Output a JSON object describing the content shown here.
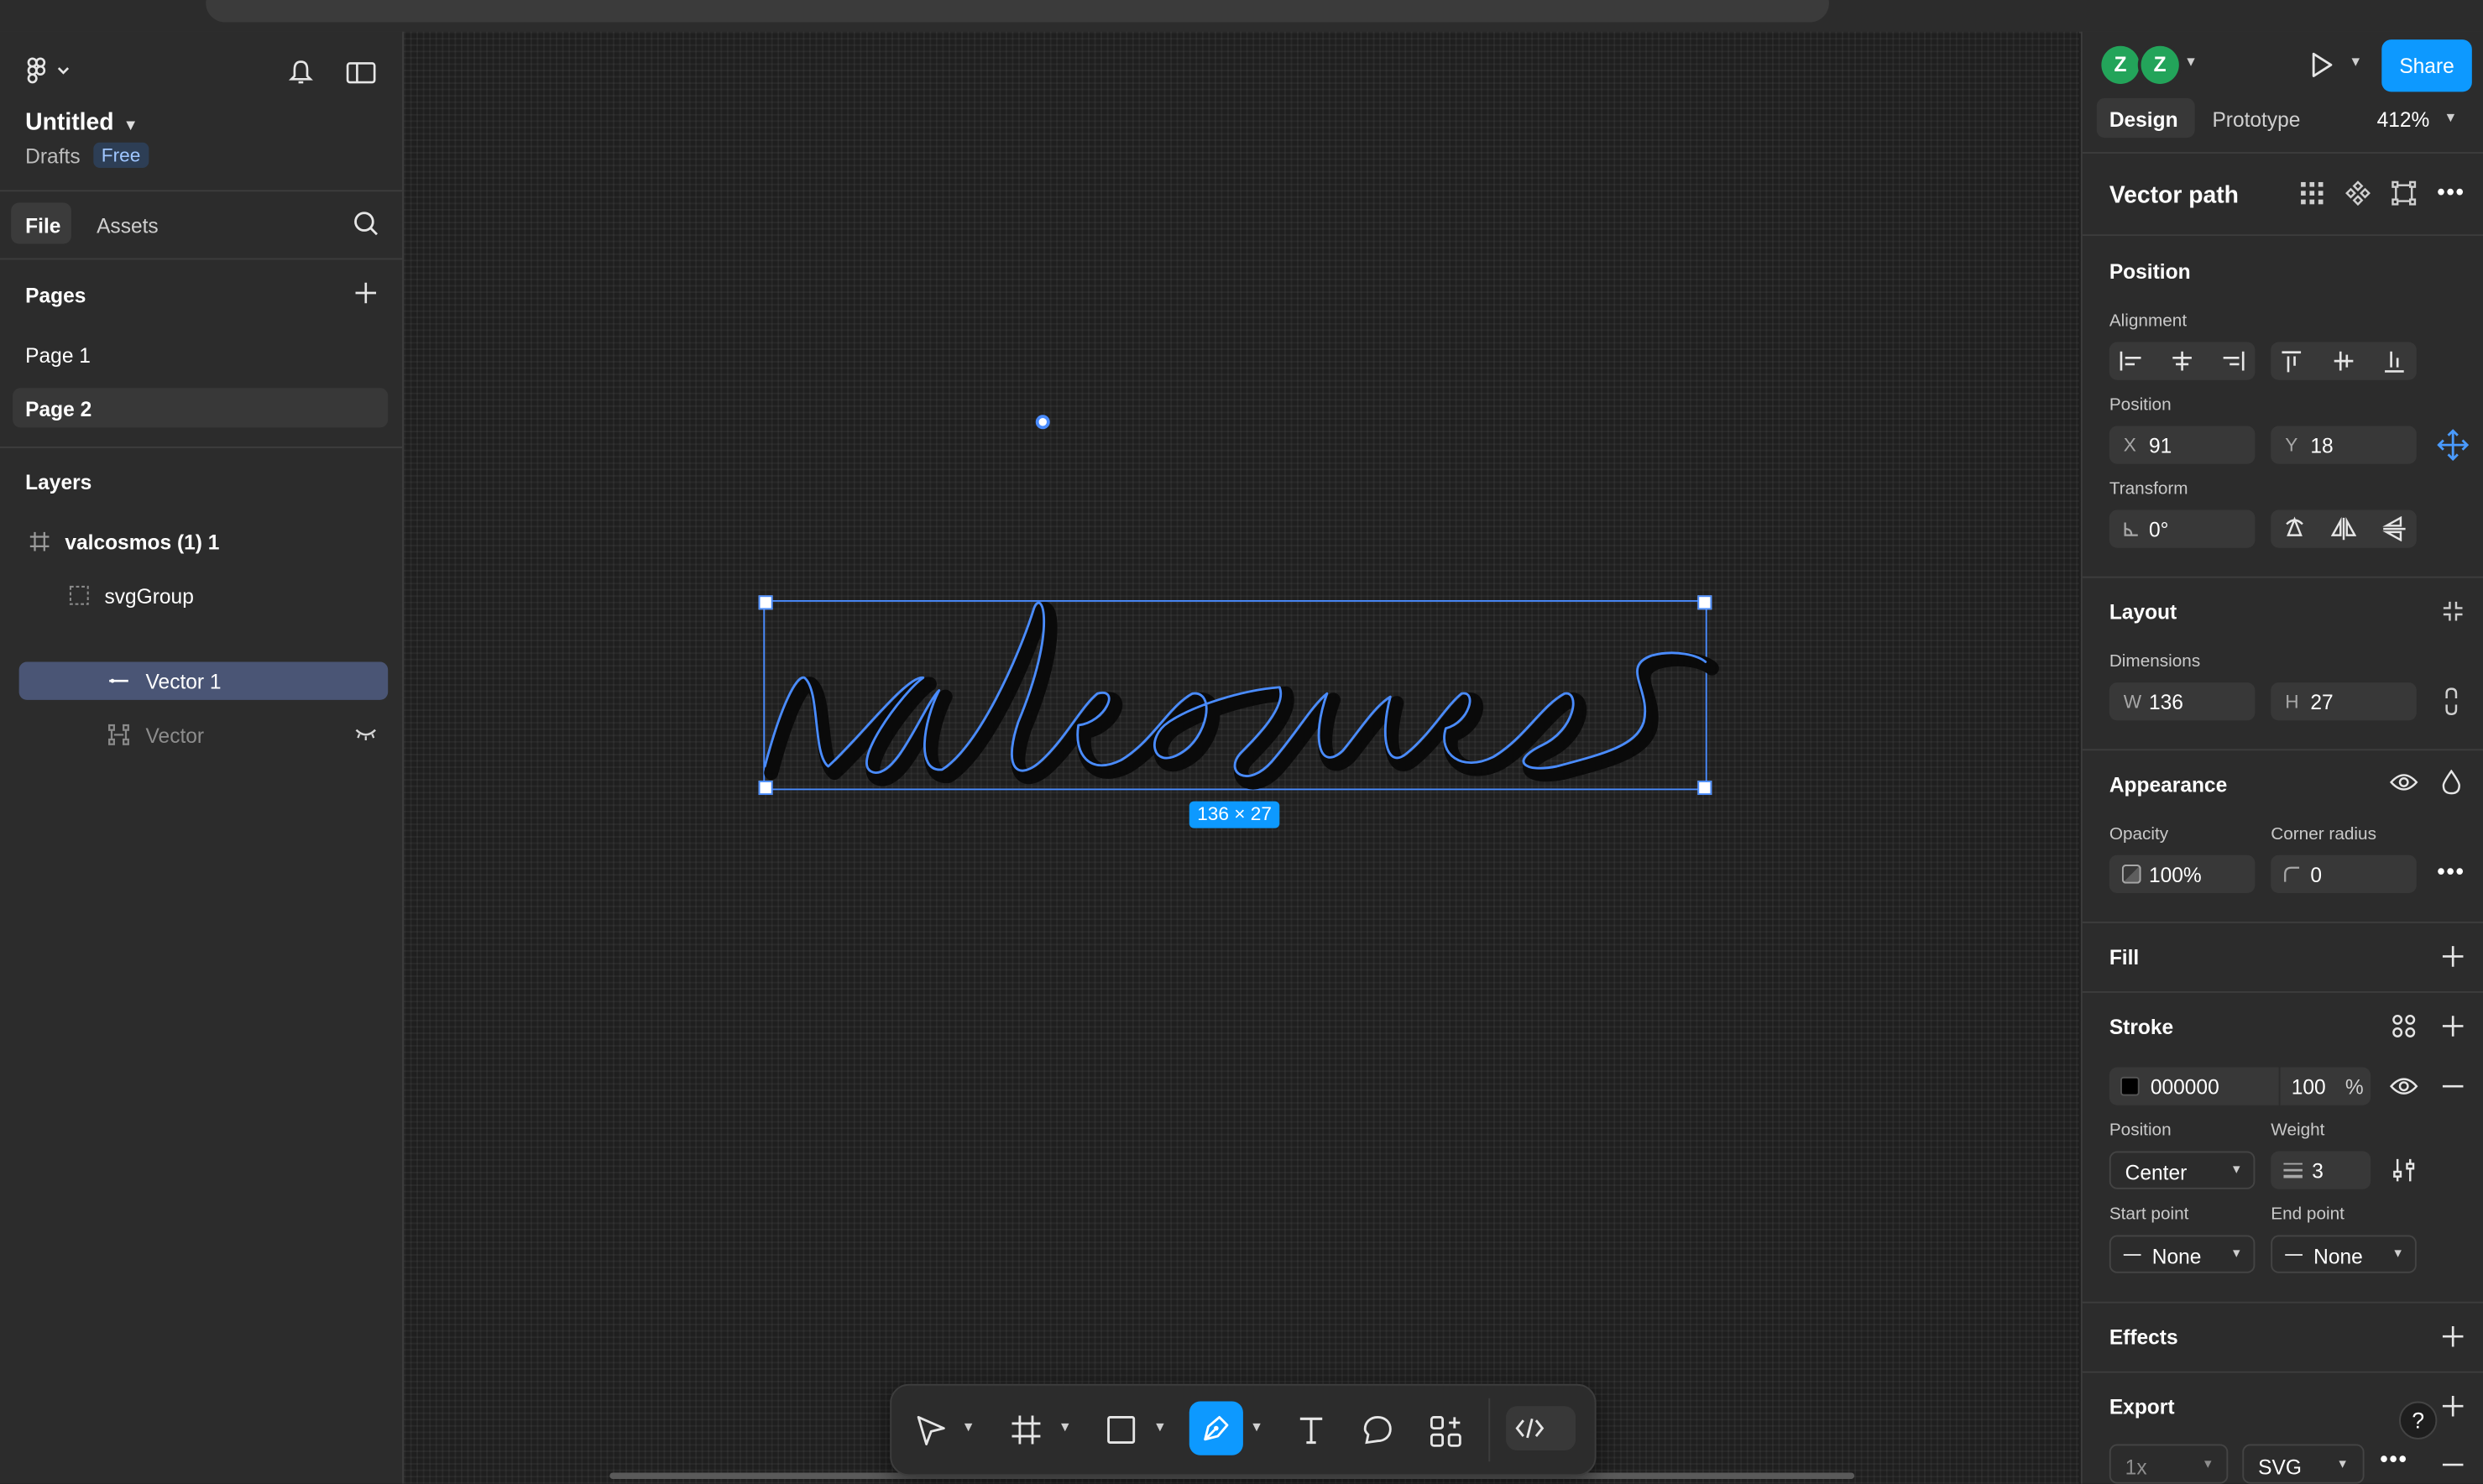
{
  "file": {
    "title": "Untitled",
    "location": "Drafts",
    "plan_badge": "Free"
  },
  "left_tabs": {
    "file": "File",
    "assets": "Assets"
  },
  "pages": {
    "heading": "Pages",
    "items": [
      "Page 1",
      "Page 2"
    ],
    "selected": "Page 2"
  },
  "layers": {
    "heading": "Layers",
    "items": [
      {
        "label": "valcosmos (1) 1",
        "icon": "frame-icon"
      },
      {
        "label": "svgGroup",
        "icon": "group-icon"
      },
      {
        "label": "Vector 1",
        "icon": "vector-line-icon",
        "selected": true
      },
      {
        "label": "Vector",
        "icon": "vector-icon",
        "hidden": true
      }
    ]
  },
  "canvas": {
    "selection_size_label": "136 × 27",
    "artwork_text": "valeosmes"
  },
  "header": {
    "avatars": [
      "Z",
      "Z"
    ],
    "share_label": "Share",
    "tabs": [
      "Design",
      "Prototype"
    ],
    "zoom": "412%"
  },
  "inspector": {
    "title": "Vector path",
    "position_section": "Position",
    "alignment_label": "Alignment",
    "position_label": "Position",
    "x_label": "X",
    "x_value": "91",
    "y_label": "Y",
    "y_value": "18",
    "transform_label": "Transform",
    "rotation": "0°",
    "layout_section": "Layout",
    "dimensions_label": "Dimensions",
    "w_label": "W",
    "w_value": "136",
    "h_label": "H",
    "h_value": "27",
    "appearance_section": "Appearance",
    "opacity_label": "Opacity",
    "opacity_value": "100%",
    "corner_label": "Corner radius",
    "corner_value": "0",
    "fill_section": "Fill",
    "stroke_section": "Stroke",
    "stroke_color": "000000",
    "stroke_opacity": "100",
    "stroke_percent": "%",
    "stroke_position_label": "Position",
    "stroke_position": "Center",
    "weight_label": "Weight",
    "weight_value": "3",
    "start_point_label": "Start point",
    "start_point": "None",
    "end_point_label": "End point",
    "end_point": "None",
    "effects_section": "Effects",
    "export_section": "Export",
    "export_scale": "1x",
    "export_format": "SVG",
    "help": "?"
  },
  "colors": {
    "accent": "#0d99ff",
    "selection": "#4a8cff",
    "avatar": "#23a45a",
    "panel": "#2c2c2c",
    "canvas": "#1f1f1f"
  }
}
